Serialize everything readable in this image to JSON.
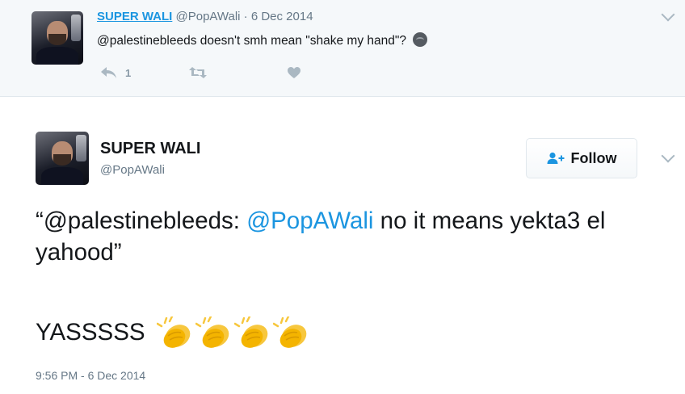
{
  "parent_tweet": {
    "display_name": "SUPER WALI",
    "handle": "@PopAWali",
    "date": "· 6 Dec 2014",
    "text": "@palestinebleeds doesn't smh mean \"shake my hand\"?",
    "emoji": "smh-face-emoji",
    "reply_count": "1",
    "icons": [
      "reply-icon",
      "retweet-icon",
      "like-icon",
      "chevron-down-icon"
    ]
  },
  "main_tweet": {
    "display_name": "SUPER WALI",
    "handle": "@PopAWali",
    "follow_label": "Follow",
    "text_open": "“@palestinebleeds: ",
    "mention": "@PopAWali",
    "text_rest": " no it means yekta3 el yahood”",
    "text_line2": "YASSSSS",
    "emoji": [
      "clapping-hands-emoji",
      "clapping-hands-emoji",
      "clapping-hands-emoji",
      "clapping-hands-emoji"
    ],
    "timestamp": "9:56 PM - 6 Dec 2014"
  },
  "colors": {
    "link": "#1b95e0",
    "text": "#14171a",
    "muted": "#657786",
    "action_icon": "#aab8c2",
    "parent_bg": "#f5f8fa",
    "clap_yellow": "#f7c73e"
  }
}
